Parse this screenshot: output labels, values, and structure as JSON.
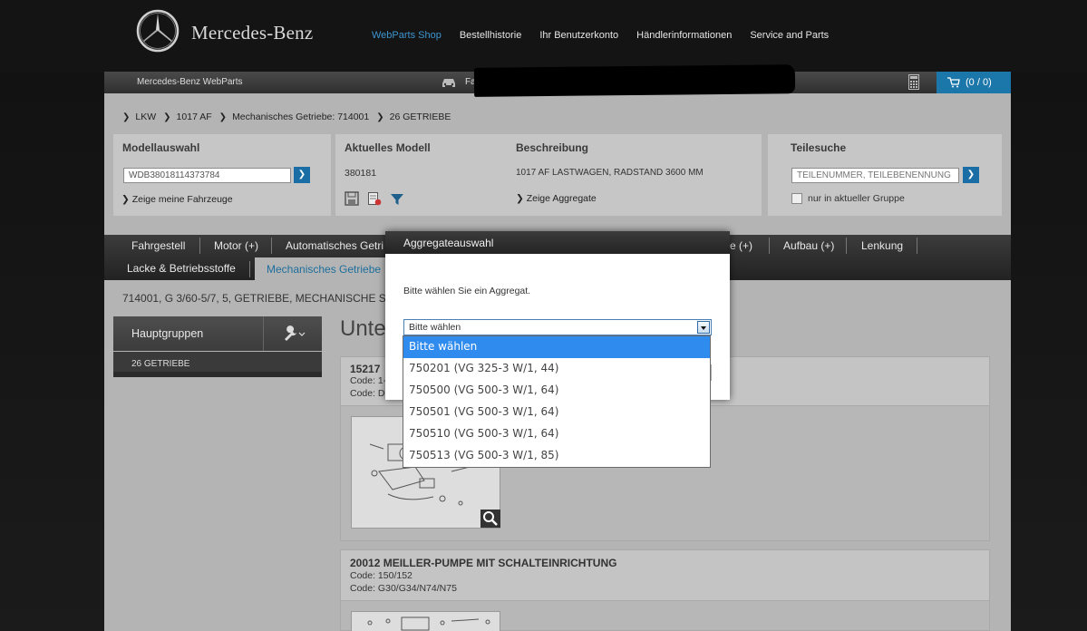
{
  "header": {
    "logo_text": "Mercedes-Benz",
    "nav": [
      {
        "label": "WebParts Shop",
        "active": true
      },
      {
        "label": "Bestellhistorie"
      },
      {
        "label": "Ihr Benutzerkonto"
      },
      {
        "label": "Händlerinformationen"
      },
      {
        "label": "Service and Parts"
      }
    ]
  },
  "subheader": {
    "brand": "Mercedes-Benz WebParts",
    "vehicle_label": "Fa",
    "cart": "(0 / 0)"
  },
  "breadcrumb": [
    "LKW",
    "1017 AF",
    "Mechanisches Getriebe: 714001",
    "26 GETRIEBE"
  ],
  "modellauswahl": {
    "title": "Modellauswahl",
    "vin_value": "WDB38018114373784",
    "link": "Zeige meine Fahrzeuge"
  },
  "aktuelles_modell": {
    "title": "Aktuelles Modell",
    "value": "380181"
  },
  "beschreibung": {
    "title": "Beschreibung",
    "value": "1017 AF LASTWAGEN, RADSTAND 3600 MM",
    "link": "Zeige Aggregate"
  },
  "teilesuche": {
    "title": "Teilesuche",
    "placeholder": "TEILENUMMER, TEILEBENENNUNG",
    "checkbox_label": "nur in aktueller Gruppe"
  },
  "tabs": {
    "row1": [
      "Fahrgestell",
      "Motor (+)",
      "Automatisches Getri",
      "e (+)",
      "Aufbau (+)",
      "Lenkung"
    ],
    "row2": [
      "Lacke & Betriebsstoffe"
    ],
    "active": "Mechanisches Getriebe"
  },
  "description_line": "714001, G 3/60-5/7, 5, GETRIEBE, MECHANISCHE S",
  "sidebar": {
    "header": "Hauptgruppen",
    "items": [
      "26 GETRIEBE"
    ]
  },
  "main": {
    "heading": "Unte",
    "cards": [
      {
        "title": "15217",
        "code1": "Code: 1-",
        "code2": "Code: D"
      },
      {
        "title": "20012 MEILLER-PUMPE MIT SCHALTEINRICHTUNG",
        "code1": "Code: 150/152",
        "code2": "Code: G30/G34/N74/N75"
      }
    ]
  },
  "modal": {
    "title": "Aggregateauswahl",
    "prompt": "Bitte wählen Sie ein Aggregat.",
    "select_value": "Bitte wählen",
    "options": [
      "Bitte wählen",
      "750201 (VG 325-3 W/1, 44)",
      "750500 (VG 500-3 W/1, 64)",
      "750501 (VG 500-3 W/1, 64)",
      "750510 (VG 500-3 W/1, 64)",
      "750513 (VG 500-3 W/1, 85)"
    ],
    "selected_index": 0
  },
  "colors": {
    "accent": "#1b76aa",
    "nav_active": "#3d95d0",
    "option_highlight": "#2f8bee"
  }
}
